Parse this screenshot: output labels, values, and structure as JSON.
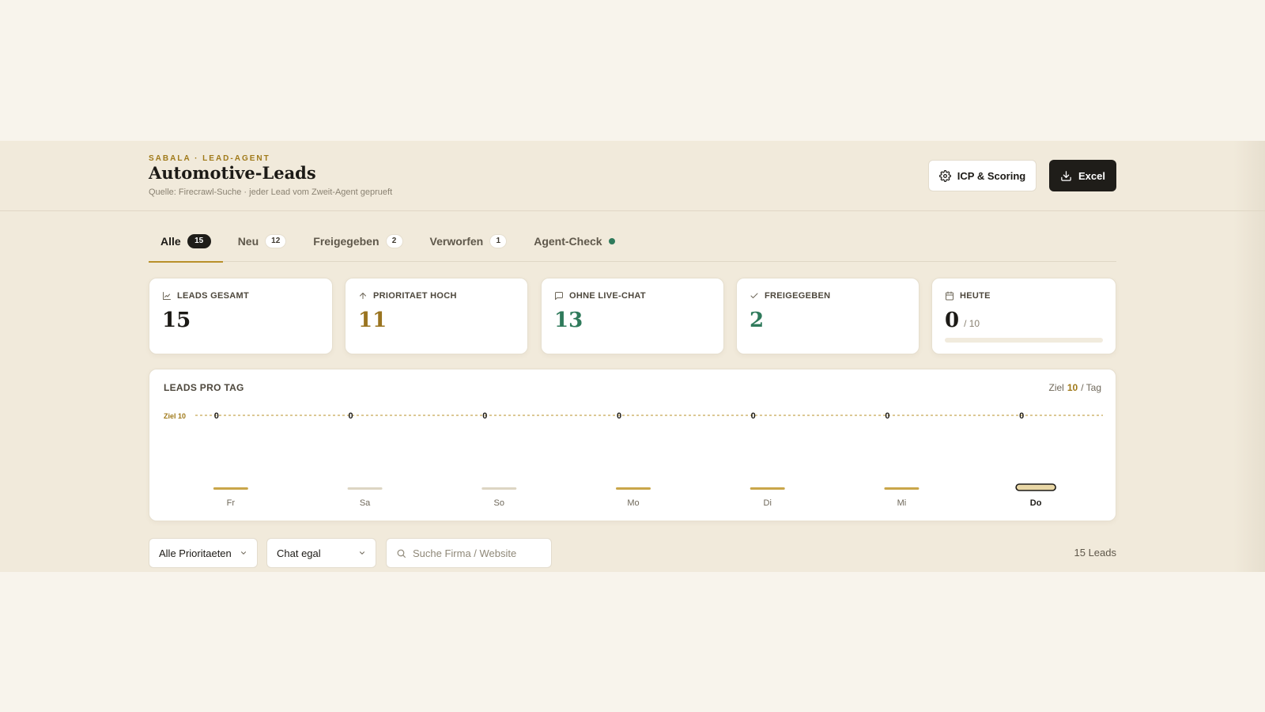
{
  "header": {
    "eyebrow": "SABALA · LEAD-AGENT",
    "title": "Automotive-Leads",
    "subtitle": "Quelle: Firecrawl-Suche · jeder Lead vom Zweit-Agent geprueft",
    "icp_button": "ICP & Scoring",
    "excel_button": "Excel"
  },
  "tabs": [
    {
      "label": "Alle",
      "count": "15",
      "active": true
    },
    {
      "label": "Neu",
      "count": "12"
    },
    {
      "label": "Freigegeben",
      "count": "2"
    },
    {
      "label": "Verworfen",
      "count": "1"
    },
    {
      "label": "Agent-Check",
      "status": "online"
    }
  ],
  "kpis": [
    {
      "label": "LEADS GESAMT",
      "value": "15",
      "icon": "chart-icon",
      "color": "#1c1a16"
    },
    {
      "label": "PRIORITAET HOCH",
      "value": "11",
      "icon": "arrow-up-icon",
      "color": "#9a7420"
    },
    {
      "label": "OHNE LIVE-CHAT",
      "value": "13",
      "icon": "chat-icon",
      "color": "#2f7a5b"
    },
    {
      "label": "FREIGEGEBEN",
      "value": "2",
      "icon": "check-icon",
      "color": "#2f7a5b"
    },
    {
      "label": "HEUTE",
      "value": "0",
      "suffix": "/ 10",
      "icon": "calendar-icon",
      "color": "#1c1a16",
      "progress": 0
    }
  ],
  "chart": {
    "title": "LEADS PRO TAG",
    "goal_prefix": "Ziel",
    "goal_value": "10",
    "goal_suffix": "/ Tag",
    "goal_line_label": "Ziel 10"
  },
  "chart_data": {
    "type": "bar",
    "title": "LEADS PRO TAG",
    "categories": [
      "Fr",
      "Sa",
      "So",
      "Mo",
      "Di",
      "Mi",
      "Do"
    ],
    "values": [
      0,
      0,
      0,
      0,
      0,
      0,
      0
    ],
    "goal": 10,
    "current_day": "Do",
    "weekend_days": [
      "Sa",
      "So"
    ],
    "colors": {
      "weekday": "#c9a64a",
      "weekend": "#ddd5c3",
      "goal_line": "#b8902a"
    }
  },
  "filters": {
    "priority": "Alle Prioritaeten",
    "chat": "Chat egal",
    "search_placeholder": "Suche Firma / Website",
    "lead_count": "15 Leads"
  }
}
